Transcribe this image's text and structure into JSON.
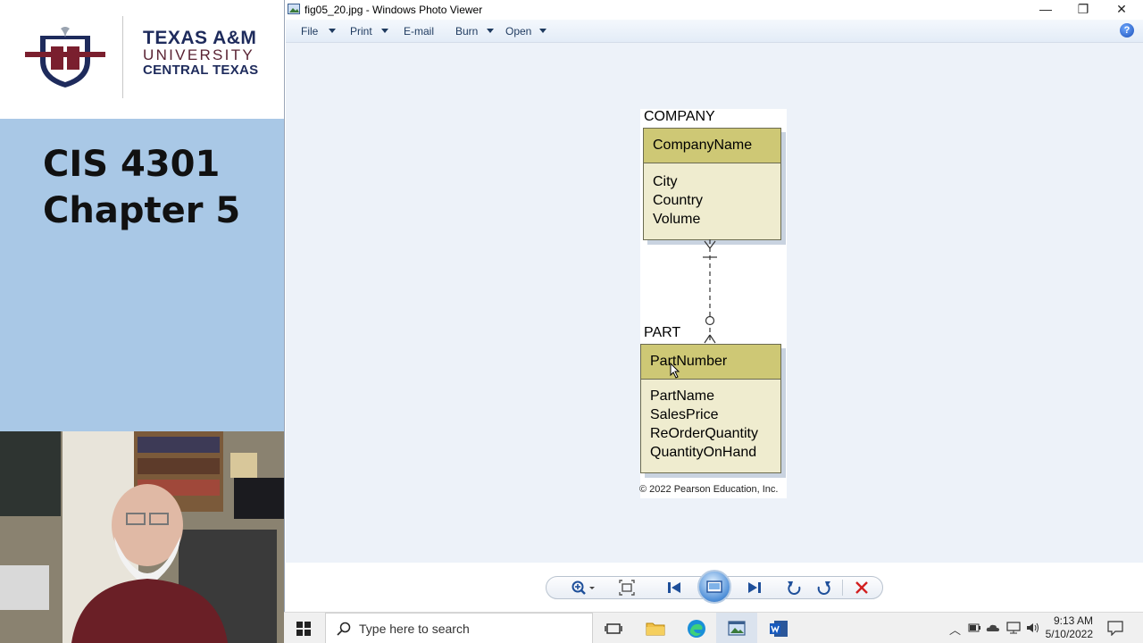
{
  "slide": {
    "logo": {
      "line1": "TEXAS A&M",
      "line2": "UNIVERSITY",
      "line3": "CENTRAL TEXAS"
    },
    "course_code": "CIS 4301",
    "chapter": "Chapter 5"
  },
  "window": {
    "title": "fig05_20.jpg - Windows Photo Viewer",
    "controls": {
      "minimize": "—",
      "restore": "❐",
      "close": "✕"
    }
  },
  "menu": [
    {
      "label": "File",
      "has_dropdown": true
    },
    {
      "label": "Print",
      "has_dropdown": true
    },
    {
      "label": "E-mail",
      "has_dropdown": false
    },
    {
      "label": "Burn",
      "has_dropdown": true
    },
    {
      "label": "Open",
      "has_dropdown": true
    }
  ],
  "help": "?",
  "figure": {
    "entity1": {
      "name": "COMPANY",
      "key": "CompanyName",
      "attributes": [
        "City",
        "Country",
        "Volume"
      ]
    },
    "entity2": {
      "name": "PART",
      "key": "PartNumber",
      "attributes": [
        "PartName",
        "SalesPrice",
        "ReOrderQuantity",
        "QuantityOnHand"
      ]
    },
    "copyright": "© 2022 Pearson Education, Inc."
  },
  "controls": {
    "zoom": "zoom-icon",
    "actual_size": "actual-size-icon",
    "previous": "previous-icon",
    "slideshow": "slideshow-icon",
    "next": "next-icon",
    "rotate_ccw": "rotate-counterclockwise-icon",
    "rotate_cw": "rotate-clockwise-icon",
    "delete": "delete-icon"
  },
  "taskbar": {
    "search_placeholder": "Type here to search",
    "time": "9:13 AM",
    "date": "5/10/2022"
  },
  "colors": {
    "slide_bg": "#a9c8e6",
    "entity_key_fill": "#cec875",
    "entity_body_fill": "#efeccf",
    "delete_red": "#d21f1f"
  }
}
